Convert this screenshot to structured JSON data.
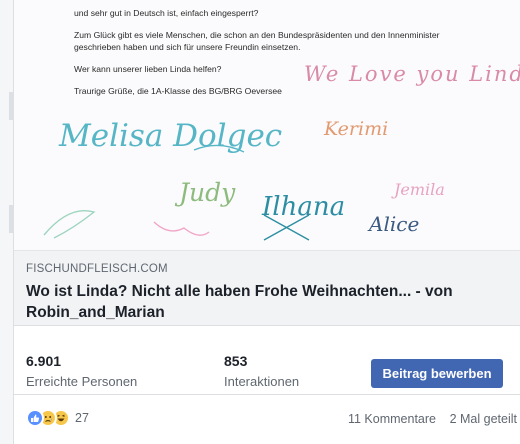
{
  "post_image": {
    "letter_lines": [
      "und sehr gut in Deutsch ist, einfach eingesperrt?",
      "Zum Glück gibt es viele Menschen, die schon an den Bundespräsidenten und den Innenminister",
      "geschrieben haben und sich für unsere Freundin einsetzen.",
      "Wer kann unserer lieben Linda helfen?",
      "Traurige Grüße, die 1A-Klasse des BG/BRG Oeversee"
    ],
    "signatures": [
      "We Love you Linda",
      "Melisa Dolgec",
      "Kerimi",
      "Judy",
      "Ilhana",
      "Jemila",
      "Alice"
    ]
  },
  "link_preview": {
    "domain": "FISCHUNDFLEISCH.COM",
    "title": "Wo ist Linda? Nicht alle haben Frohe Weihnachten... - von Robin_and_Marian"
  },
  "insights": {
    "reach_value": "6.901",
    "reach_label": "Erreichte Personen",
    "interactions_value": "853",
    "interactions_label": "Interaktionen",
    "boost_label": "Beitrag bewerben"
  },
  "engagement": {
    "reaction_icons": [
      "like-icon",
      "sad-icon",
      "haha-icon"
    ],
    "reaction_count": "27",
    "comments": "11 Kommentare",
    "shares": "2 Mal geteilt"
  },
  "colors": {
    "accent": "#4267b2",
    "secondary_text": "#606770",
    "preview_bg": "#f2f3f5",
    "ink_blue": "#3fa7b5",
    "ink_pink": "#d98aa6",
    "ink_orange": "#e29a70"
  }
}
